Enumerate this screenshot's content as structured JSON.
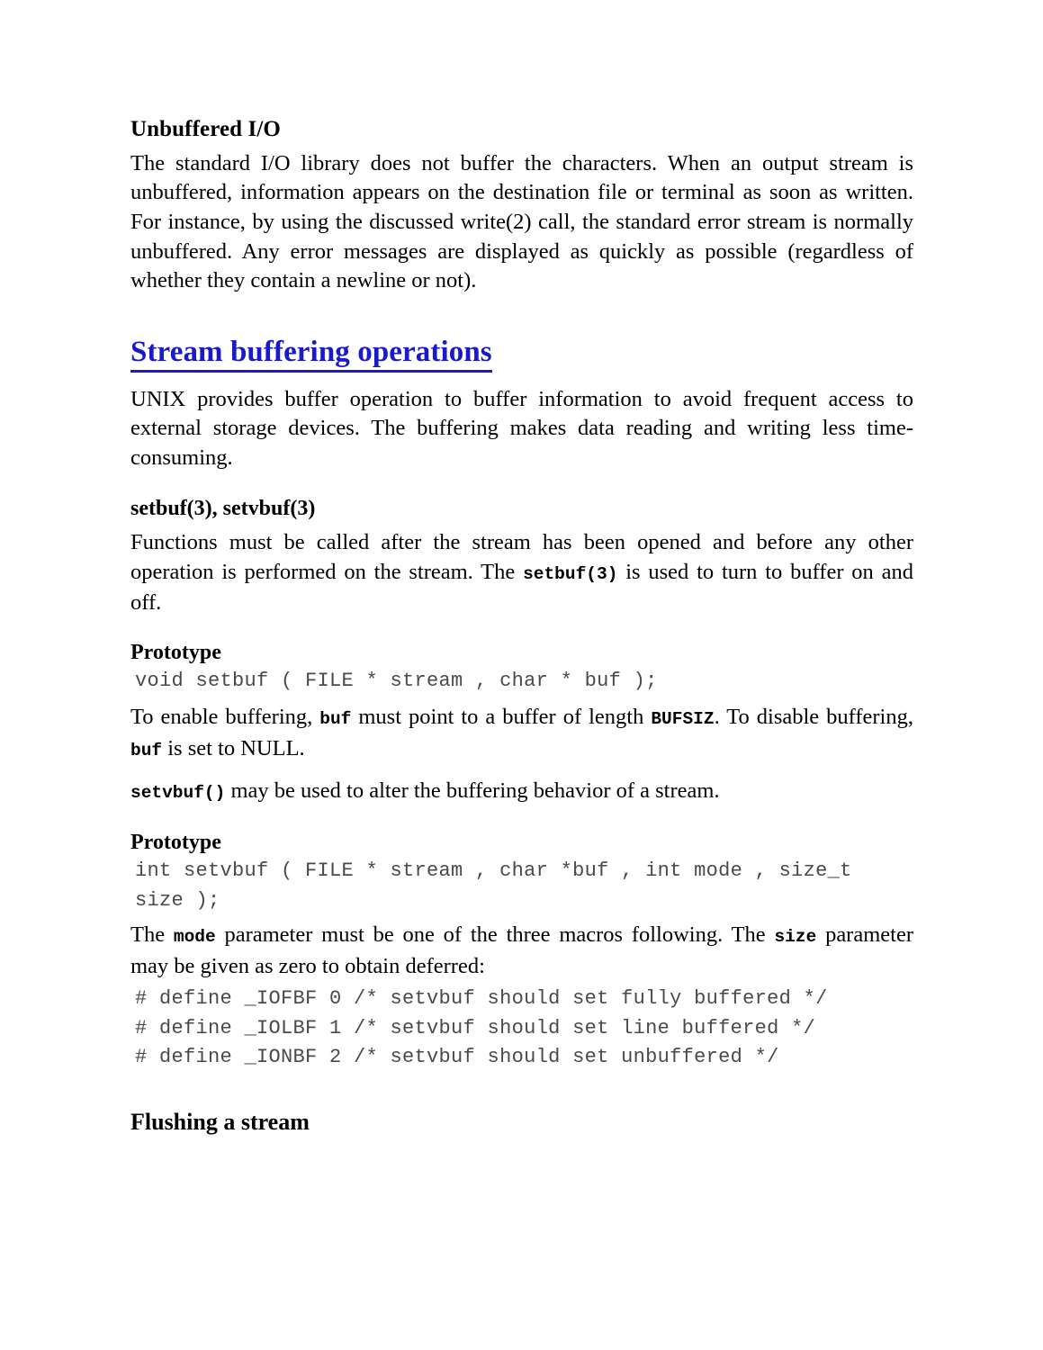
{
  "document": {
    "colors": {
      "text": "#000000",
      "accent_blue": "#1a1ac8",
      "code_gray": "#4a4a4a",
      "page_background": "#ffffff"
    },
    "sections": [
      {
        "id": "unbuffered-io",
        "heading": "Unbuffered I/O",
        "paragraph": "The standard I/O library does not buffer the characters. When an output stream is unbuffered, information appears on the destination file or terminal as soon as written. For instance, by using the discussed write(2) call, the standard error stream is normally unbuffered. Any error messages are displayed as quickly as possible (regardless of whether they contain a newline or not)."
      },
      {
        "id": "stream-buffering-operations",
        "heading": "Stream buffering operations",
        "paragraph": "UNIX provides buffer operation to buffer information to avoid frequent access to external storage devices. The buffering makes data reading and writing less time-consuming."
      },
      {
        "id": "setbuf-setvbuf",
        "heading": "setbuf(3), setvbuf(3)",
        "paragraph_part_1": "Functions must be called after the stream has been opened and before any other operation is performed on the stream. The ",
        "inline_code_1": "setbuf(3)",
        "paragraph_part_2": " is used to turn to buffer on and off."
      }
    ],
    "prototype_1": {
      "heading": "Prototype",
      "code": "void setbuf ( FILE * stream , char * buf );"
    },
    "buffer_note": {
      "part_1": "To enable buffering, ",
      "code_1": "buf",
      "part_2": " must point to a buffer of length ",
      "code_2": "BUFSIZ",
      "part_3": ". To disable buffering, ",
      "code_3": "buf",
      "part_4": " is set to NULL."
    },
    "setvbuf_note": {
      "code_1": "setvbuf()",
      "part_1": " may be used to alter the buffering behavior of a stream."
    },
    "prototype_2": {
      "heading": "Prototype",
      "code_line_1": "int setvbuf ( FILE * stream , char *buf , int mode , size_t",
      "code_line_2": "size );"
    },
    "mode_note": {
      "part_1": "The ",
      "code_1": "mode",
      "part_2": " parameter must be one of the three macros following. The ",
      "code_2": "size",
      "part_3": " parameter may be given as zero to obtain deferred:"
    },
    "define_block": {
      "lines": [
        "# define _IOFBF 0 /* setvbuf should set fully buffered */",
        "# define _IOLBF 1 /* setvbuf should set line buffered */",
        "# define _IONBF 2 /* setvbuf should set unbuffered */"
      ]
    },
    "final_heading": "Flushing a stream"
  }
}
